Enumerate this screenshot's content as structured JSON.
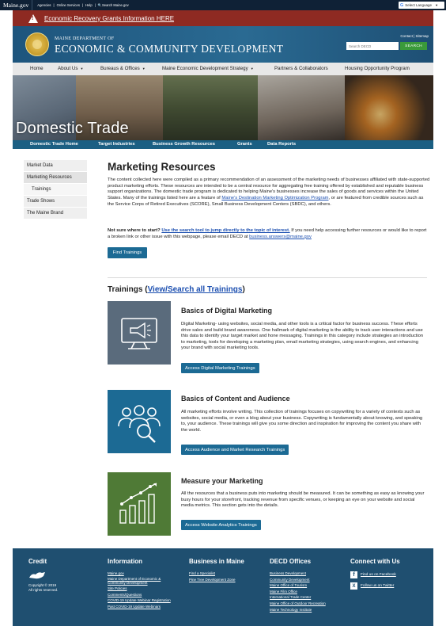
{
  "topbar": {
    "logo": "Maine.gov",
    "links": [
      "Agencies",
      "|",
      "Online Services",
      "|",
      "Help",
      "|",
      "🔍Search Maine.gov"
    ],
    "language_label": "Select Language"
  },
  "alert": {
    "text": "Economic Recovery Grants Information HERE"
  },
  "header": {
    "dept_small": "MAINE DEPARTMENT OF",
    "dept_big": "ECONOMIC & COMMUNITY DEVELOPMENT",
    "contact": "Contact | Sitemap",
    "search_placeholder": "Search DECD",
    "search_button": "SEARCH"
  },
  "main_nav": {
    "items": [
      {
        "label": "Home",
        "caret": false
      },
      {
        "label": "About Us",
        "caret": true
      },
      {
        "label": "Bureaus & Offices",
        "caret": true
      },
      {
        "label": "Maine Economic Development Strategy",
        "caret": true
      },
      {
        "label": "Partners & Collaborators",
        "caret": false
      },
      {
        "label": "Housing Opportunity Program",
        "caret": false
      }
    ]
  },
  "hero": {
    "title": "Domestic Trade"
  },
  "sub_nav": {
    "items": [
      "Domestic Trade Home",
      "Target Industries",
      "Business Growth Resources",
      "Grants",
      "Data Reports"
    ]
  },
  "sidebar": {
    "items": [
      {
        "label": "Market Data"
      },
      {
        "label": "Marketing Resources"
      },
      {
        "label": "Trainings"
      },
      {
        "label": "Trade Shows"
      },
      {
        "label": "The Maine Brand"
      }
    ]
  },
  "content": {
    "title": "Marketing Resources",
    "intro_1": "The content collected here were compiled as a primary recommendation of an assessment of the marketing needs of businesses affiliated with state-supported product marketing efforts. These resources are intended to be a central resource for aggregating free training offered by established and reputable business support organizations. The domestic trade program is dedicated to helping Maine's businesses increase the sales of goods and services within the United States. Many of the trainings listed here are a feature of ",
    "intro_link": "Maine's Destination Marketing Optimization Program",
    "intro_2": ", or are featured from credible sources such as the Service Corps of Retired Executives (SCORE), Small Business Development Centers (SBDC), and others.",
    "not_sure_bold": "Not sure where to start?",
    "not_sure_link": "Use the search tool to jump directly to the topic of interest.",
    "not_sure_text": " If you need help accessing further resources or would like to report a broken link or other issue with this webpage, please email DECD at ",
    "email_link": "business.answers@maine.gov",
    "find_button": "Find Trainings",
    "trainings_prefix": "Trainings (",
    "trainings_link": "View/Search all Trainings",
    "trainings_suffix": ")"
  },
  "cards": [
    {
      "title": "Basics of Digital Marketing",
      "body": "Digital Marketing- using websites, social media, and other tools is a critical factor for business success. These efforts drive sales and build brand awareness. One hallmark of digital marketing is the ability to track user interactions and use this data to identify your target market and hone messaging.  Trainings in this category include strategies an introduction to marketing, tools for developing a marketing plan, email marketing strategies, using search engines, and enhancing your brand with social marketing tools.",
      "button": "Access Digital Marketing Trainings",
      "icon": "megaphone-monitor-icon",
      "color": "#5a6b7c"
    },
    {
      "title": "Basics of Content and Audience",
      "body": "All marketing efforts involve writing. This collection of trainings focuses on copywriting for a variety of contexts such as websites, social media, or even a blog about your business. Copywriting is fundamentally about knowing, and speaking to, your audience. These trainings will give you some direction and inspiration for improving the content you share with the world.",
      "button": "Access Audience and Market Research Trainings",
      "icon": "audience-search-icon",
      "color": "#1c6a94"
    },
    {
      "title": "Measure your Marketing",
      "body": "All the resources that a business puts into marketing should be measured. It can be something as easy as knowing your busy hours for your storefront, tracking revenue from specific venues, or keeping an eye on your website and social media metrics. This section gets into the details.",
      "button": "Access Website Analytics Trainings",
      "icon": "growth-chart-icon",
      "color": "#4f7a36"
    }
  ],
  "footer": {
    "credit": {
      "heading": "Credit",
      "lines": [
        "Copyright © 2019",
        "All rights reserved."
      ]
    },
    "information": {
      "heading": "Information",
      "links": [
        "Maine.gov",
        "Maine Department of Economic &",
        "Community Development",
        "Site Policies",
        "Comments/Questions",
        "COVID-19 Update Webinar Registration",
        "Past COVID-19 Update Webinars"
      ]
    },
    "business": {
      "heading": "Business in Maine",
      "links": [
        "Find a Specialist",
        "Pine Tree Development Zone"
      ]
    },
    "offices": {
      "heading": "DECD Offices",
      "links": [
        "Business Development",
        "Community Development",
        "Maine Office of Tourism",
        "Maine Film Office",
        "International Trade Center",
        "Maine Office of Outdoor Recreation",
        "Maine Technology Institute"
      ]
    },
    "connect": {
      "heading": "Connect with Us",
      "links": [
        "Find us on Facebook",
        "Follow us on Twitter"
      ]
    }
  }
}
